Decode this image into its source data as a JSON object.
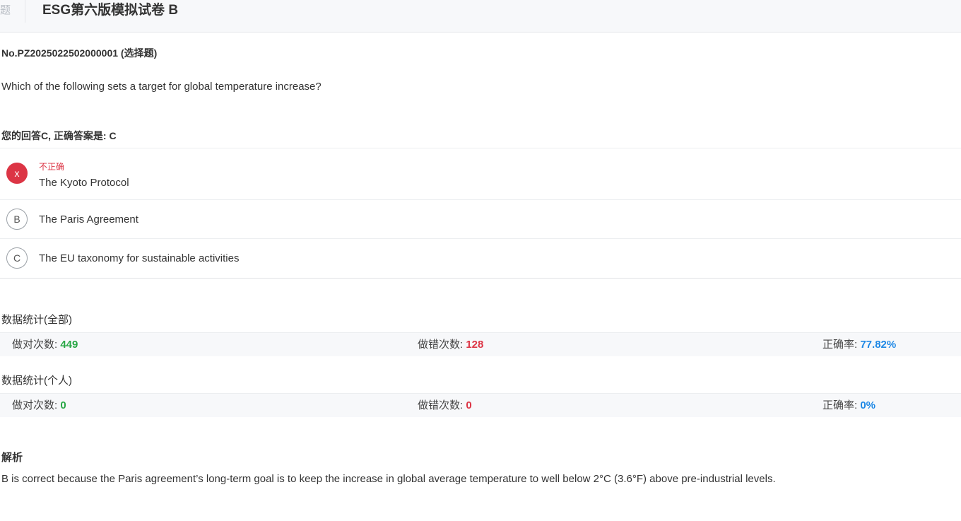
{
  "header": {
    "back_label": "题",
    "title": "ESG第六版模拟试卷 B"
  },
  "question": {
    "number_line": "No.PZ2025022502000001 (选择题)",
    "text": "Which of the following sets a target for global temperature increase?",
    "answer_line": "您的回答C, 正确答案是: C"
  },
  "options": [
    {
      "badge": "x",
      "status": "不正确",
      "text": "The Kyoto Protocol"
    },
    {
      "badge": "B",
      "text": "The Paris Agreement"
    },
    {
      "badge": "C",
      "text": "The EU taxonomy for sustainable activities"
    }
  ],
  "stats_all": {
    "title": "数据统计(全部)",
    "correct_label": "做对次数: ",
    "correct_value": "449",
    "wrong_label": "做错次数: ",
    "wrong_value": "128",
    "rate_label": "正确率: ",
    "rate_value": "77.82%"
  },
  "stats_personal": {
    "title": "数据统计(个人)",
    "correct_label": "做对次数: ",
    "correct_value": "0",
    "wrong_label": "做错次数: ",
    "wrong_value": "0",
    "rate_label": "正确率: ",
    "rate_value": "0%"
  },
  "analysis": {
    "title": "解析",
    "text": "B is correct because the Paris agreement’s long-term goal is to keep the increase in global average temperature to well below 2°C (3.6°F) above pre-industrial levels."
  },
  "colors": {
    "wrong": "#dc3545",
    "correct_count": "#28a745",
    "wrong_count": "#dc3545",
    "rate": "#1e88e5"
  }
}
